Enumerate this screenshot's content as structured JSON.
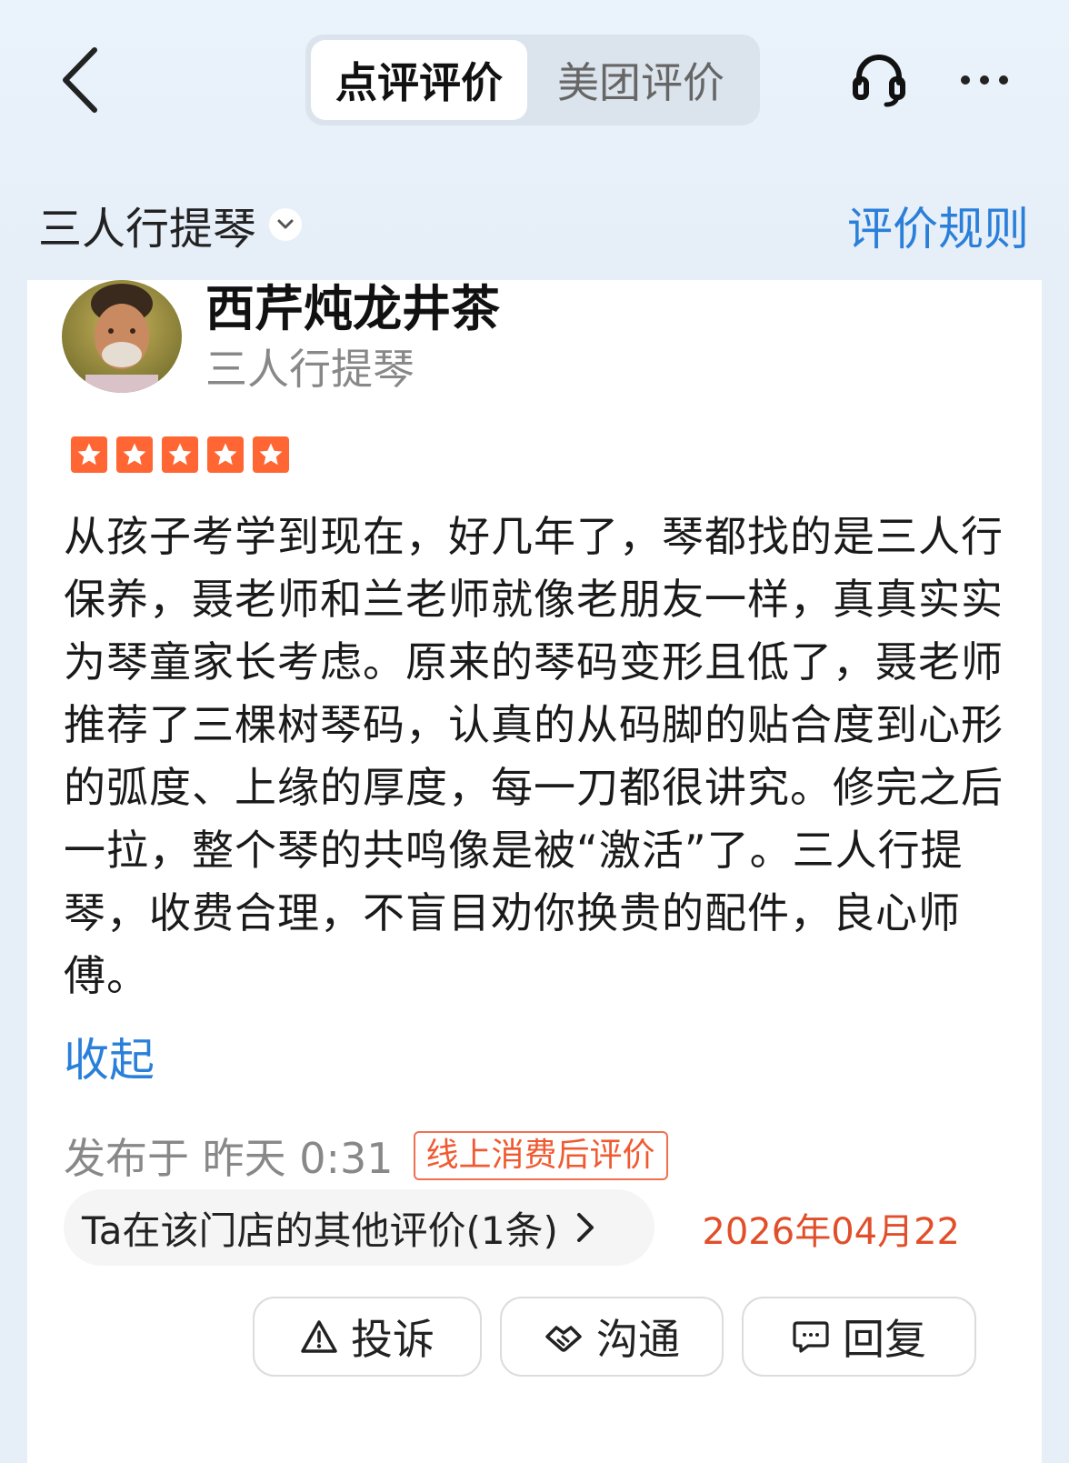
{
  "header": {
    "tabs": [
      {
        "label": "点评评价",
        "active": true
      },
      {
        "label": "美团评价",
        "active": false
      }
    ],
    "icons": {
      "back": "chevron-left-icon",
      "support": "headset-icon",
      "more": "more-dots-icon"
    }
  },
  "shop": {
    "name": "三人行提琴",
    "rules_link": "评价规则"
  },
  "review": {
    "username": "西芹炖龙井茶",
    "shop_name": "三人行提琴",
    "rating": 5,
    "text": "从孩子考学到现在，好几年了，琴都找的是三人行保养，聂老师和兰老师就像老朋友一样，真真实实为琴童家长考虑。原来的琴码变形且低了，聂老师推荐了三棵树琴码，认真的从码脚的贴合度到心形的弧度、上缘的厚度，每一刀都很讲究。修完之后一拉，整个琴的共鸣像是被“激活”了。三人行提琴，收费合理，不盲目劝你换贵的配件，良心师傅。",
    "collapse_label": "收起",
    "published": "发布于 昨天 0:31",
    "badge": "线上消费后评价",
    "other_reviews": "Ta在该门店的其他评价(1条)",
    "date": "2026年04月22"
  },
  "actions": {
    "complain": "投诉",
    "talk": "沟通",
    "reply": "回复"
  },
  "colors": {
    "accent_blue": "#2a7fd9",
    "star_orange": "#ff6633",
    "badge_red": "#f05a30",
    "date_red": "#e14f2a"
  }
}
